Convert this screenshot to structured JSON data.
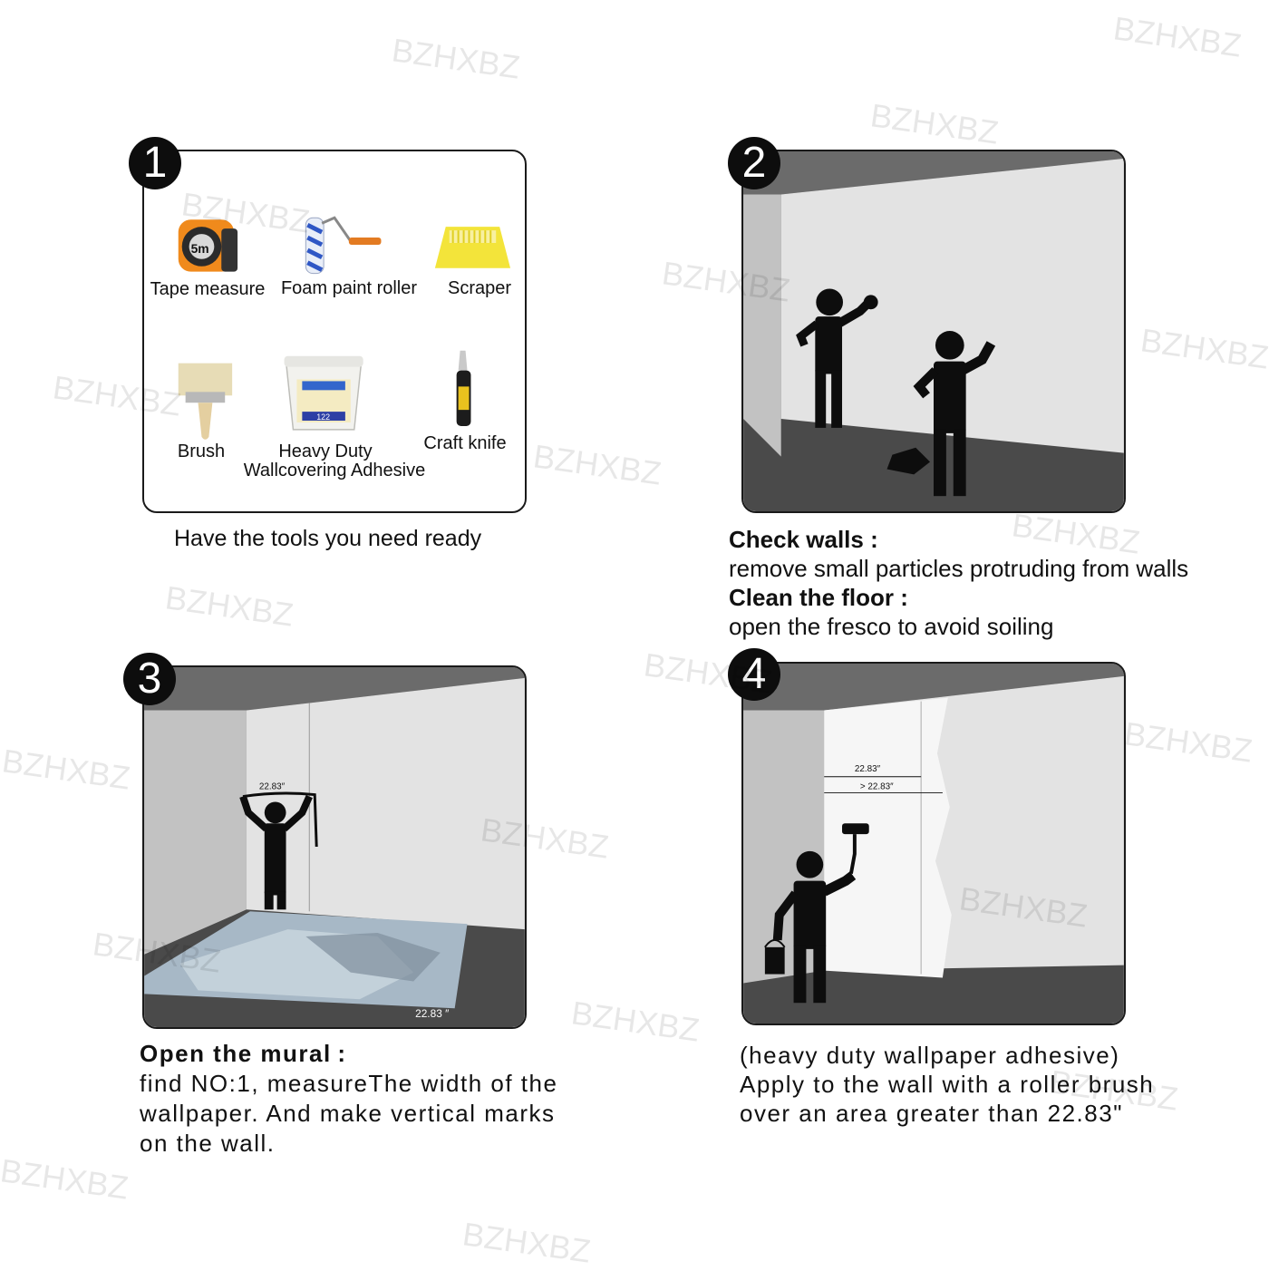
{
  "watermark": "BZHXBZ",
  "steps": [
    {
      "number": "1",
      "tools": [
        {
          "label": "Tape measure",
          "icon": "tape-measure-icon"
        },
        {
          "label": "Foam paint roller",
          "icon": "paint-roller-icon"
        },
        {
          "label": "Scraper",
          "icon": "scraper-icon"
        },
        {
          "label": "Brush",
          "icon": "brush-icon"
        },
        {
          "label_line1": "Heavy Duty",
          "label_line2": "Wallcovering Adhesive",
          "icon": "adhesive-bucket-icon"
        },
        {
          "label": "Craft knife",
          "icon": "craft-knife-icon"
        }
      ],
      "caption": "Have the tools you need ready"
    },
    {
      "number": "2",
      "heading1": "Check walls :",
      "text1": "remove small particles protruding from walls",
      "heading2": "Clean the floor :",
      "text2": "open the fresco to avoid soiling"
    },
    {
      "number": "3",
      "measure_label": "22.83″",
      "floor_label": "22.83 ″",
      "heading": "Open the mural :",
      "line1": "find NO:1, measureThe width of the",
      "line2": "wallpaper. And make vertical marks",
      "line3": "on the wall."
    },
    {
      "number": "4",
      "measure_label1": "22.83″",
      "measure_label2": "> 22.83″",
      "line1": "(heavy duty wallpaper adhesive)",
      "line2": "Apply to the wall with a roller brush",
      "line3": "over an area greater than 22.83\""
    }
  ],
  "colors": {
    "ceiling": "#6b6b6b",
    "wall_side": "#c2c2c2",
    "wall_main": "#e3e3e3",
    "floor": "#4a4a4a",
    "figure": "#0d0d0d"
  }
}
